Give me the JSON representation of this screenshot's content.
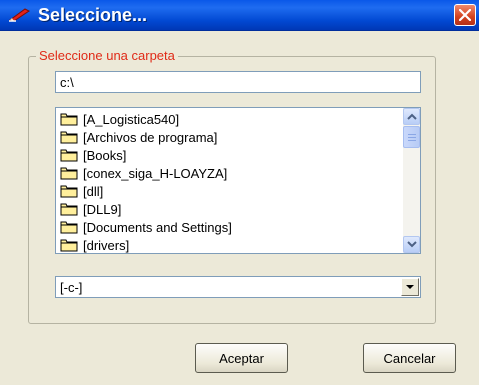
{
  "window": {
    "title": "Seleccione...",
    "accent": "#0a58e8",
    "close_color": "#d2411d"
  },
  "group": {
    "legend": "Seleccione una carpeta",
    "legend_color": "#e02b18"
  },
  "path": {
    "value": "c:\\"
  },
  "folders": [
    {
      "label": "[A_Logistica540]"
    },
    {
      "label": "[Archivos de programa]"
    },
    {
      "label": "[Books]"
    },
    {
      "label": "[conex_siga_H-LOAYZA]"
    },
    {
      "label": "[dll]"
    },
    {
      "label": "[DLL9]"
    },
    {
      "label": "[Documents and Settings]"
    },
    {
      "label": "[drivers]"
    }
  ],
  "drive": {
    "selected": "[-c-]"
  },
  "buttons": {
    "ok_label": "Aceptar",
    "cancel_label": "Cancelar"
  },
  "icons": {
    "app": "pencil-icon",
    "close": "close-icon",
    "folder": "folder-icon",
    "scroll_up": "chevron-up-icon",
    "scroll_down": "chevron-down-icon",
    "dropdown": "dropdown-arrow-icon"
  }
}
